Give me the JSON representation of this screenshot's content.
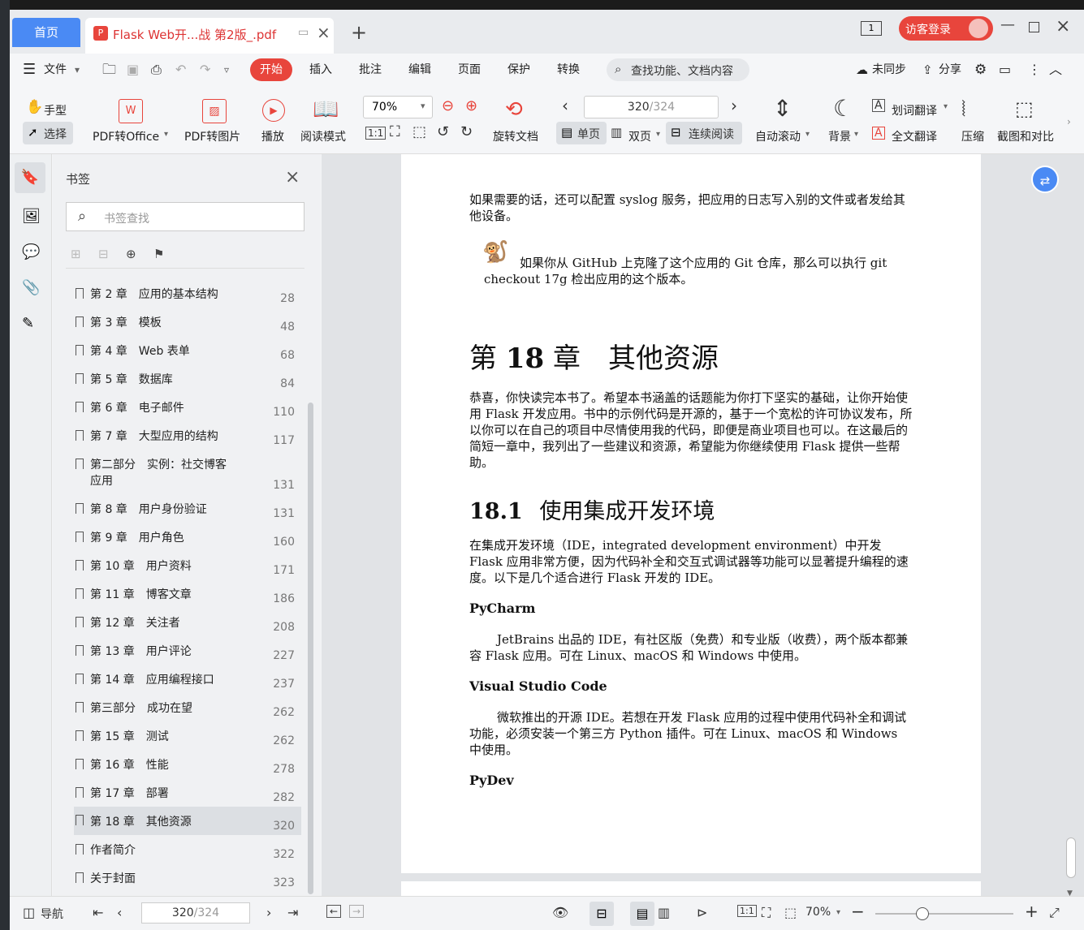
{
  "tabs": {
    "home": "首页",
    "doc_title": "Flask Web开...战 第2版_.pdf",
    "guest_login": "访客登录"
  },
  "menu": {
    "file": "文件",
    "items": [
      "开始",
      "插入",
      "批注",
      "编辑",
      "页面",
      "保护",
      "转换"
    ],
    "search_placeholder": "查找功能、文档内容",
    "unsynced": "未同步",
    "share": "分享"
  },
  "toolbar": {
    "hand": "手型",
    "select": "选择",
    "pdf_to_office": "PDF转Office",
    "pdf_to_image": "PDF转图片",
    "play": "播放",
    "read_mode": "阅读模式",
    "zoom": "70%",
    "rotate": "旋转文档",
    "page_current": "320",
    "page_total": "/324",
    "single": "单页",
    "double": "双页",
    "continuous": "连续阅读",
    "auto_scroll": "自动滚动",
    "background": "背景",
    "word_translate": "划词翻译",
    "full_translate": "全文翻译",
    "compress": "压缩",
    "screenshot_compare": "截图和对比"
  },
  "bookmarks": {
    "title": "书签",
    "search_placeholder": "书签查找",
    "items": [
      {
        "label": "第 2 章　应用的基本结构",
        "page": "28"
      },
      {
        "label": "第 3 章　模板",
        "page": "48"
      },
      {
        "label": "第 4 章　Web 表单",
        "page": "68"
      },
      {
        "label": "第 5 章　数据库",
        "page": "84"
      },
      {
        "label": "第 6 章　电子邮件",
        "page": "110"
      },
      {
        "label": "第 7 章　大型应用的结构",
        "page": "117"
      },
      {
        "label": "第二部分　实例：社交博客",
        "label2": "应用",
        "page": "131"
      },
      {
        "label": "第 8 章　用户身份验证",
        "page": "131"
      },
      {
        "label": "第 9 章　用户角色",
        "page": "160"
      },
      {
        "label": "第 10 章　用户资料",
        "page": "171"
      },
      {
        "label": "第 11 章　博客文章",
        "page": "186"
      },
      {
        "label": "第 12 章　关注者",
        "page": "208"
      },
      {
        "label": "第 13 章　用户评论",
        "page": "227"
      },
      {
        "label": "第 14 章　应用编程接口",
        "page": "237"
      },
      {
        "label": "第三部分　成功在望",
        "page": "262"
      },
      {
        "label": "第 15 章　测试",
        "page": "262"
      },
      {
        "label": "第 16 章　性能",
        "page": "278"
      },
      {
        "label": "第 17 章　部署",
        "page": "282"
      },
      {
        "label": "第 18 章　其他资源",
        "page": "320"
      },
      {
        "label": "作者简介",
        "page": "322"
      },
      {
        "label": "关于封面",
        "page": "323"
      }
    ]
  },
  "document": {
    "p1": "如果需要的话，还可以配置 syslog 服务，把应用的日志写入别的文件或者发给其他设备。",
    "note": "如果你从 GitHub 上克隆了这个应用的 Git 仓库，那么可以执行 git checkout 17g 检出应用的这个版本。",
    "chapter_prefix": "第",
    "chapter_num": "18",
    "chapter_suffix": "章　其他资源",
    "p2": "恭喜，你快读完本书了。希望本书涵盖的话题能为你打下坚实的基础，让你开始使用 Flask 开发应用。书中的示例代码是开源的，基于一个宽松的许可协议发布，所以你可以在自己的项目中尽情使用我的代码，即便是商业项目也可以。在这最后的简短一章中，我列出了一些建议和资源，希望能为你继续使用 Flask 提供一些帮助。",
    "section_num": "18.1",
    "section_title": "使用集成开发环境",
    "p3": "在集成开发环境（IDE，integrated development environment）中开发 Flask 应用非常方便，因为代码补全和交互式调试器等功能可以显著提升编程的速度。以下是几个适合进行 Flask 开发的 IDE。",
    "h_pycharm": "PyCharm",
    "p_pycharm": "JetBrains 出品的 IDE，有社区版（免费）和专业版（收费），两个版本都兼容 Flask 应用。可在 Linux、macOS 和 Windows 中使用。",
    "h_vscode": "Visual Studio Code",
    "p_vscode": "微软推出的开源 IDE。若想在开发 Flask 应用的过程中使用代码补全和调试功能，必须安装一个第三方 Python 插件。可在 Linux、macOS 和 Windows 中使用。",
    "h_pydev": "PyDev"
  },
  "status": {
    "nav": "导航",
    "page_current": "320",
    "page_total": "/324",
    "zoom": "70%"
  },
  "colors": {
    "accent": "#4a8af4",
    "start_tab": "#e8453c"
  }
}
